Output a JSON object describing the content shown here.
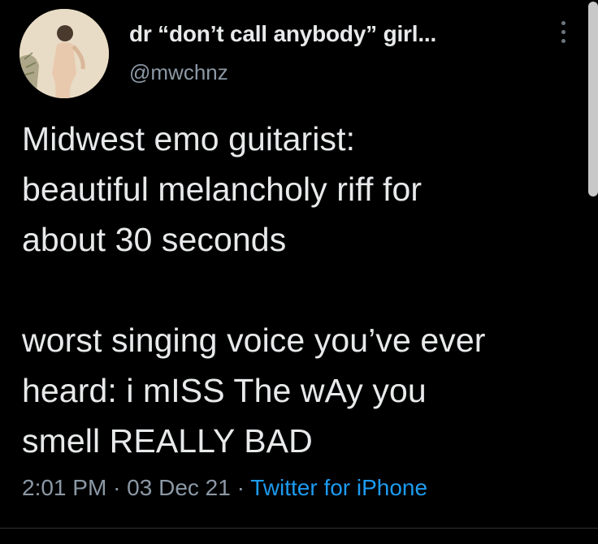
{
  "tweet": {
    "author": {
      "display_name": "dr “don’t call anybody” girl...",
      "handle": "@mwchnz",
      "avatar": "avatar"
    },
    "text": {
      "paragraph_1": "Midwest emo guitarist:\nbeautiful melancholy riff for\nabout 30 seconds",
      "paragraph_2": "worst singing voice you’ve ever\nheard: i mISS The wAy you\nsmell REALLY BAD"
    },
    "time": "2:01 PM",
    "date": "03 Dec 21",
    "separator": "·",
    "source": "Twitter for iPhone",
    "more_icon": "more-vertical-icon"
  },
  "colors": {
    "background": "#000000",
    "primary_text": "#e7e9ea",
    "secondary_text": "#8b98a5",
    "link": "#1d9bf0"
  }
}
